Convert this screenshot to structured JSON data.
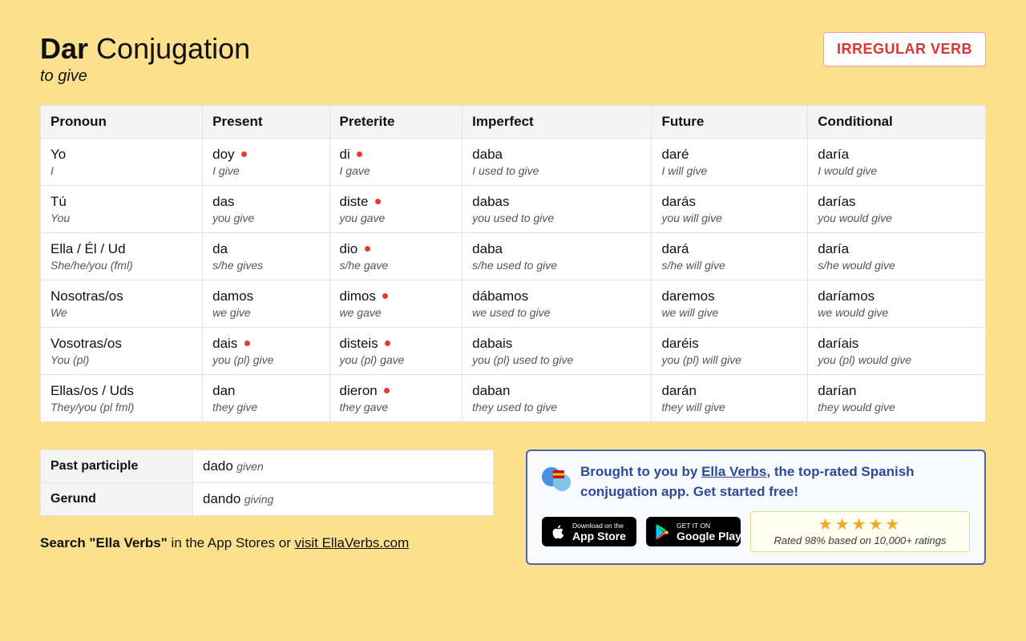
{
  "header": {
    "verb": "Dar",
    "title_rest": "Conjugation",
    "subtitle": "to give",
    "badge": "IRREGULAR VERB"
  },
  "columns": [
    "Pronoun",
    "Present",
    "Preterite",
    "Imperfect",
    "Future",
    "Conditional"
  ],
  "pronouns": [
    {
      "es": "Yo",
      "en": "I"
    },
    {
      "es": "Tú",
      "en": "You"
    },
    {
      "es": "Ella / Él / Ud",
      "en": "She/he/you (fml)"
    },
    {
      "es": "Nosotras/os",
      "en": "We"
    },
    {
      "es": "Vosotras/os",
      "en": "You (pl)"
    },
    {
      "es": "Ellas/os / Uds",
      "en": "They/you (pl fml)"
    }
  ],
  "tenses": {
    "present": [
      {
        "es": "doy",
        "en": "I give",
        "irr": true
      },
      {
        "es": "das",
        "en": "you give",
        "irr": false
      },
      {
        "es": "da",
        "en": "s/he gives",
        "irr": false
      },
      {
        "es": "damos",
        "en": "we give",
        "irr": false
      },
      {
        "es": "dais",
        "en": "you (pl) give",
        "irr": true
      },
      {
        "es": "dan",
        "en": "they give",
        "irr": false
      }
    ],
    "preterite": [
      {
        "es": "di",
        "en": "I gave",
        "irr": true
      },
      {
        "es": "diste",
        "en": "you gave",
        "irr": true
      },
      {
        "es": "dio",
        "en": "s/he gave",
        "irr": true
      },
      {
        "es": "dimos",
        "en": "we gave",
        "irr": true
      },
      {
        "es": "disteis",
        "en": "you (pl) gave",
        "irr": true
      },
      {
        "es": "dieron",
        "en": "they gave",
        "irr": true
      }
    ],
    "imperfect": [
      {
        "es": "daba",
        "en": "I used to give",
        "irr": false
      },
      {
        "es": "dabas",
        "en": "you used to give",
        "irr": false
      },
      {
        "es": "daba",
        "en": "s/he used to give",
        "irr": false
      },
      {
        "es": "dábamos",
        "en": "we used to give",
        "irr": false
      },
      {
        "es": "dabais",
        "en": "you (pl) used to give",
        "irr": false
      },
      {
        "es": "daban",
        "en": "they used to give",
        "irr": false
      }
    ],
    "future": [
      {
        "es": "daré",
        "en": "I will give",
        "irr": false
      },
      {
        "es": "darás",
        "en": "you will give",
        "irr": false
      },
      {
        "es": "dará",
        "en": "s/he will give",
        "irr": false
      },
      {
        "es": "daremos",
        "en": "we will give",
        "irr": false
      },
      {
        "es": "daréis",
        "en": "you (pl) will give",
        "irr": false
      },
      {
        "es": "darán",
        "en": "they will give",
        "irr": false
      }
    ],
    "conditional": [
      {
        "es": "daría",
        "en": "I would give",
        "irr": false
      },
      {
        "es": "darías",
        "en": "you would give",
        "irr": false
      },
      {
        "es": "daría",
        "en": "s/he would give",
        "irr": false
      },
      {
        "es": "daríamos",
        "en": "we would give",
        "irr": false
      },
      {
        "es": "daríais",
        "en": "you (pl) would give",
        "irr": false
      },
      {
        "es": "darían",
        "en": "they would give",
        "irr": false
      }
    ]
  },
  "participles": {
    "past_label": "Past participle",
    "past_es": "dado",
    "past_en": "given",
    "gerund_label": "Gerund",
    "gerund_es": "dando",
    "gerund_en": "giving"
  },
  "search_line": {
    "prefix_strong": "Search \"Ella Verbs\"",
    "middle": " in the App Stores or ",
    "link": "visit EllaVerbs.com"
  },
  "promo": {
    "text_prefix": "Brought to you by ",
    "link_text": "Ella Verbs",
    "text_suffix": ", the top-rated Spanish conjugation app. Get started free!",
    "app_store_sm": "Download on the",
    "app_store_lg": "App Store",
    "google_sm": "GET IT ON",
    "google_lg": "Google Play",
    "stars": "★★★★★",
    "rating_text": "Rated 98% based on 10,000+ ratings"
  }
}
